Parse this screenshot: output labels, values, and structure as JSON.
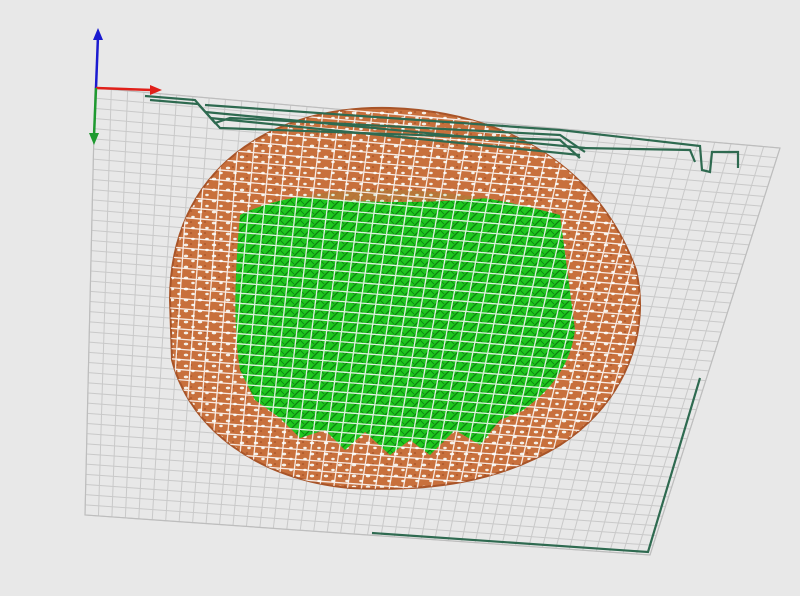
{
  "viewport": {
    "background": "#e8e8e8",
    "axes": {
      "x_color": "#e0201a",
      "y_color": "#1a1ad0",
      "z_color": "#1e9a30"
    },
    "grid_color": "#c8c8c8",
    "model": {
      "shell_color": "#c8703c",
      "shell_dark": "#a85428",
      "pores_color": "#f4f0e8",
      "infill_color": "#1ec81e",
      "infill_dark": "#0e7a12",
      "toolpath_color": "#2e6a50"
    }
  }
}
